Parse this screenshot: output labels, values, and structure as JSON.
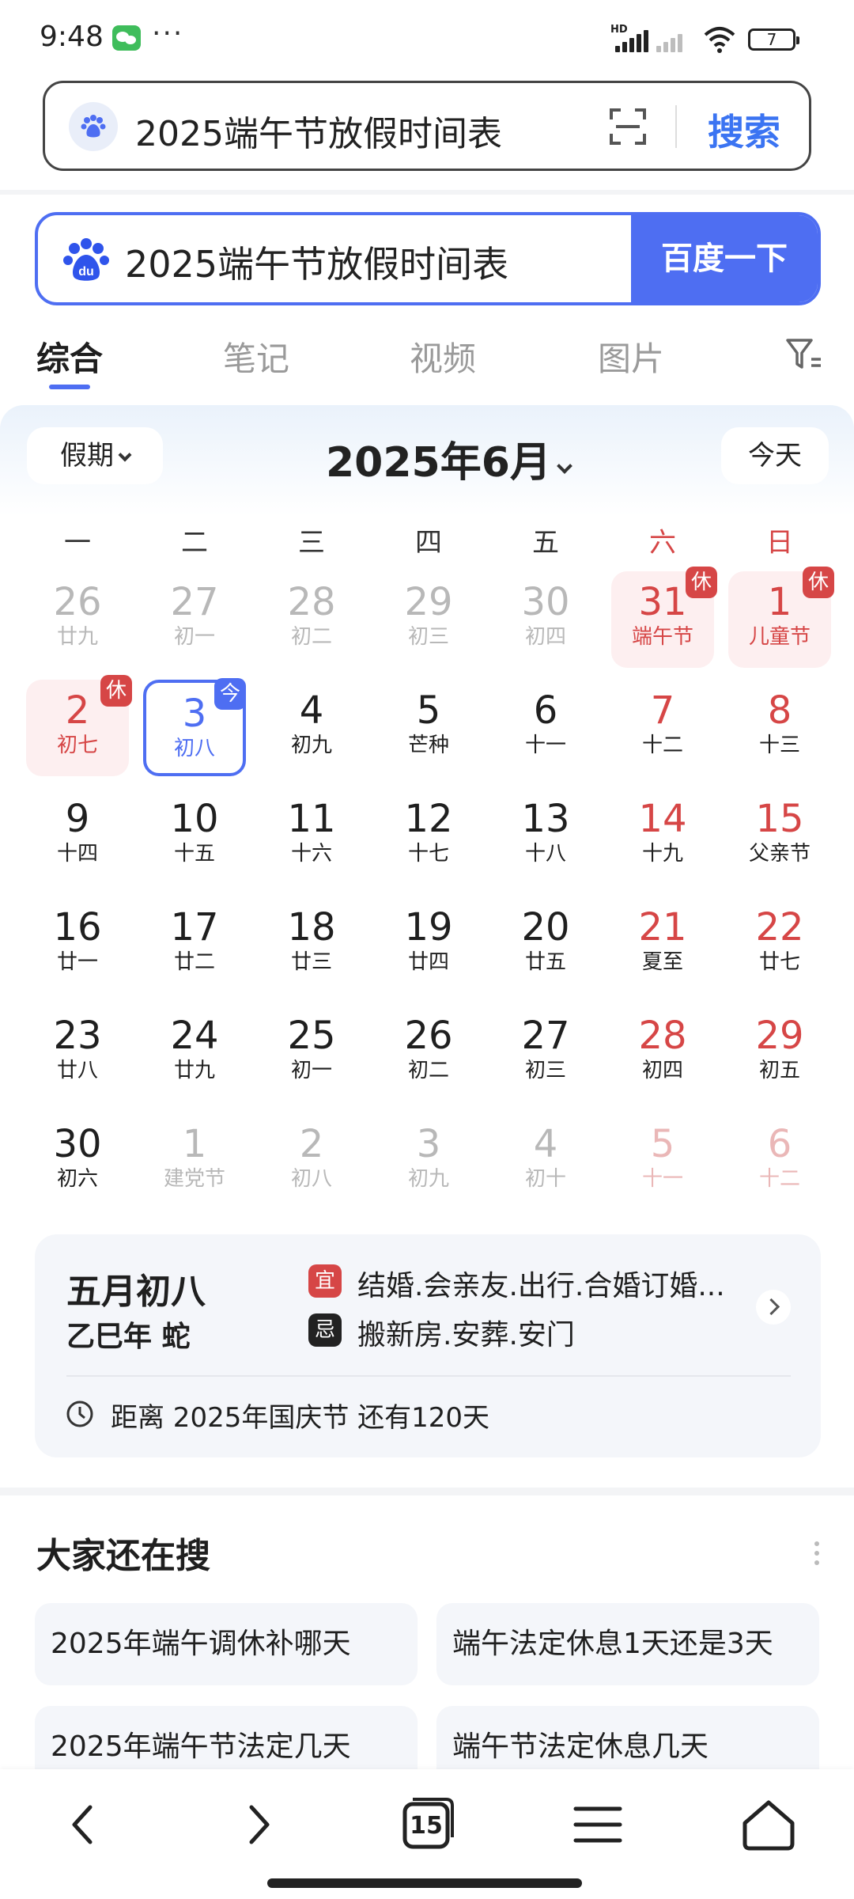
{
  "status_bar": {
    "time": "9:48",
    "battery": "7",
    "network_label": "HD"
  },
  "browser": {
    "query": "2025端午节放假时间表",
    "search_label": "搜索"
  },
  "baidu": {
    "query": "2025端午节放假时间表",
    "button_label": "百度一下"
  },
  "tabs": [
    {
      "label": "综合",
      "active": true
    },
    {
      "label": "笔记",
      "active": false
    },
    {
      "label": "视频",
      "active": false
    },
    {
      "label": "图片",
      "active": false
    }
  ],
  "calendar": {
    "holiday_selector": "假期",
    "month_title": "2025年6月",
    "today_button": "今天",
    "weekdays": [
      "一",
      "二",
      "三",
      "四",
      "五",
      "六",
      "日"
    ],
    "rest_badge": "休",
    "today_badge": "今",
    "days": [
      {
        "num": "26",
        "lunar": "廿九",
        "type": "other"
      },
      {
        "num": "27",
        "lunar": "初一",
        "type": "other"
      },
      {
        "num": "28",
        "lunar": "初二",
        "type": "other"
      },
      {
        "num": "29",
        "lunar": "初三",
        "type": "other"
      },
      {
        "num": "30",
        "lunar": "初四",
        "type": "other"
      },
      {
        "num": "31",
        "lunar": "端午节",
        "type": "holiday"
      },
      {
        "num": "1",
        "lunar": "儿童节",
        "type": "holiday"
      },
      {
        "num": "2",
        "lunar": "初七",
        "type": "holiday"
      },
      {
        "num": "3",
        "lunar": "初八",
        "type": "today"
      },
      {
        "num": "4",
        "lunar": "初九",
        "type": "normal"
      },
      {
        "num": "5",
        "lunar": "芒种",
        "type": "normal"
      },
      {
        "num": "6",
        "lunar": "十一",
        "type": "normal"
      },
      {
        "num": "7",
        "lunar": "十二",
        "type": "weekend"
      },
      {
        "num": "8",
        "lunar": "十三",
        "type": "weekend"
      },
      {
        "num": "9",
        "lunar": "十四",
        "type": "normal"
      },
      {
        "num": "10",
        "lunar": "十五",
        "type": "normal"
      },
      {
        "num": "11",
        "lunar": "十六",
        "type": "normal"
      },
      {
        "num": "12",
        "lunar": "十七",
        "type": "normal"
      },
      {
        "num": "13",
        "lunar": "十八",
        "type": "normal"
      },
      {
        "num": "14",
        "lunar": "十九",
        "type": "weekend"
      },
      {
        "num": "15",
        "lunar": "父亲节",
        "type": "weekend"
      },
      {
        "num": "16",
        "lunar": "廿一",
        "type": "normal"
      },
      {
        "num": "17",
        "lunar": "廿二",
        "type": "normal"
      },
      {
        "num": "18",
        "lunar": "廿三",
        "type": "normal"
      },
      {
        "num": "19",
        "lunar": "廿四",
        "type": "normal"
      },
      {
        "num": "20",
        "lunar": "廿五",
        "type": "normal"
      },
      {
        "num": "21",
        "lunar": "夏至",
        "type": "weekend"
      },
      {
        "num": "22",
        "lunar": "廿七",
        "type": "weekend"
      },
      {
        "num": "23",
        "lunar": "廿八",
        "type": "normal"
      },
      {
        "num": "24",
        "lunar": "廿九",
        "type": "normal"
      },
      {
        "num": "25",
        "lunar": "初一",
        "type": "normal"
      },
      {
        "num": "26",
        "lunar": "初二",
        "type": "normal"
      },
      {
        "num": "27",
        "lunar": "初三",
        "type": "normal"
      },
      {
        "num": "28",
        "lunar": "初四",
        "type": "weekend"
      },
      {
        "num": "29",
        "lunar": "初五",
        "type": "weekend"
      },
      {
        "num": "30",
        "lunar": "初六",
        "type": "normal"
      },
      {
        "num": "1",
        "lunar": "建党节",
        "type": "other"
      },
      {
        "num": "2",
        "lunar": "初八",
        "type": "other"
      },
      {
        "num": "3",
        "lunar": "初九",
        "type": "other"
      },
      {
        "num": "4",
        "lunar": "初十",
        "type": "other"
      },
      {
        "num": "5",
        "lunar": "十一",
        "type": "other-weekend"
      },
      {
        "num": "6",
        "lunar": "十二",
        "type": "other-weekend"
      }
    ],
    "rest_days": [
      5,
      6,
      7
    ]
  },
  "almanac": {
    "lunar_date": "五月初八",
    "ganzhi": "乙巳年 蛇",
    "yi_label": "宜",
    "yi_text": "结婚.会亲友.出行.合婚订婚...",
    "ji_label": "忌",
    "ji_text": "搬新房.安葬.安门",
    "countdown": "距离 2025年国庆节 还有120天"
  },
  "also_searched": {
    "title": "大家还在搜",
    "items": [
      "2025年端午调休补哪天",
      "端午法定休息1天还是3天",
      "2025年端午节法定几天",
      "端午节法定休息几天"
    ]
  },
  "bottom_nav": {
    "tab_count": "15"
  },
  "colors": {
    "accent": "#4e6ef2",
    "holiday_red": "#d64646",
    "link_blue": "#3b74f2"
  }
}
